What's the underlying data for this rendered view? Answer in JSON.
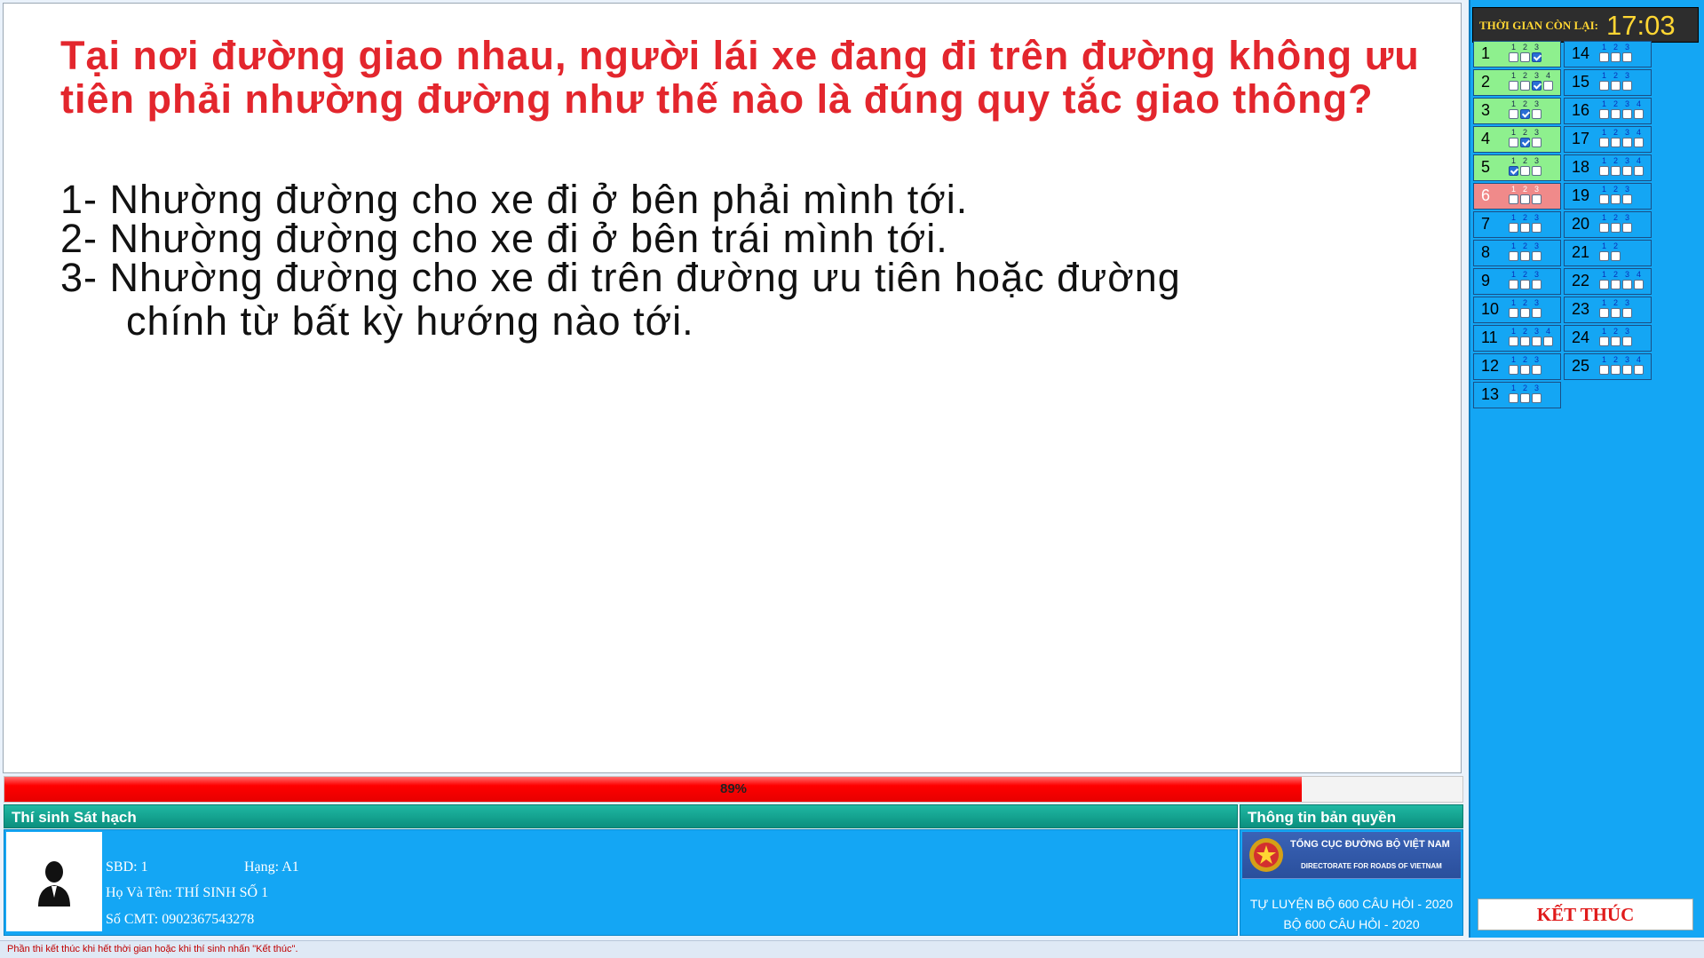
{
  "question": {
    "text": "Tại nơi đường giao nhau, người lái xe đang đi trên đường không ưu tiên phải nhường đường như thế nào là đúng quy tắc giao thông?",
    "answers": [
      {
        "num": "1- ",
        "text": "Nhường đường cho xe đi ở bên phải mình tới.",
        "cont": ""
      },
      {
        "num": "2- ",
        "text": "Nhường đường cho xe đi ở bên trái mình tới.",
        "cont": ""
      },
      {
        "num": "3- ",
        "text": "Nhường đường cho xe đi trên đường ưu tiên hoặc đường",
        "cont": "chính từ bất kỳ hướng nào tới."
      }
    ]
  },
  "progress": {
    "value": 0.89,
    "label": "89%"
  },
  "candidate": {
    "header": "Thí sinh Sát hạch",
    "sbd": "SBD: 1",
    "hang": "Hạng: A1",
    "ho_ten": "Họ Và Tên: THÍ SINH SỐ 1",
    "cmt": "Số CMT: 0902367543278",
    "avatar_icon": "person-silhouette-icon"
  },
  "copyright": {
    "header": "Thông tin bản quyền",
    "org_vi": "TỔNG CỤC ĐƯỜNG BỘ VIỆT NAM",
    "org_en": "DIRECTORATE FOR ROADS OF VIETNAM",
    "line1": "TỰ LUYỆN BỘ 600 CÂU HỎI - 2020",
    "line2": "BỘ 600 CÂU HỎI - 2020"
  },
  "timer": {
    "label": "THỜI GIAN CÒN LẠI:",
    "value": "17:03"
  },
  "questions": [
    {
      "n": "1",
      "opts": [
        "1",
        "2",
        "3"
      ],
      "checked": [
        3
      ],
      "state": "answered"
    },
    {
      "n": "2",
      "opts": [
        "1",
        "2",
        "3",
        "4"
      ],
      "checked": [
        3
      ],
      "state": "answered"
    },
    {
      "n": "3",
      "opts": [
        "1",
        "2",
        "3"
      ],
      "checked": [
        2
      ],
      "state": "answered"
    },
    {
      "n": "4",
      "opts": [
        "1",
        "2",
        "3"
      ],
      "checked": [
        2
      ],
      "state": "answered"
    },
    {
      "n": "5",
      "opts": [
        "1",
        "2",
        "3"
      ],
      "checked": [
        1
      ],
      "state": "answered"
    },
    {
      "n": "6",
      "opts": [
        "1",
        "2",
        "3"
      ],
      "checked": [],
      "state": "current"
    },
    {
      "n": "7",
      "opts": [
        "1",
        "2",
        "3"
      ],
      "checked": [],
      "state": "none"
    },
    {
      "n": "8",
      "opts": [
        "1",
        "2",
        "3"
      ],
      "checked": [],
      "state": "none"
    },
    {
      "n": "9",
      "opts": [
        "1",
        "2",
        "3"
      ],
      "checked": [],
      "state": "none"
    },
    {
      "n": "10",
      "opts": [
        "1",
        "2",
        "3"
      ],
      "checked": [],
      "state": "none"
    },
    {
      "n": "11",
      "opts": [
        "1",
        "2",
        "3",
        "4"
      ],
      "checked": [],
      "state": "none"
    },
    {
      "n": "12",
      "opts": [
        "1",
        "2",
        "3"
      ],
      "checked": [],
      "state": "none"
    },
    {
      "n": "13",
      "opts": [
        "1",
        "2",
        "3"
      ],
      "checked": [],
      "state": "none"
    },
    {
      "n": "14",
      "opts": [
        "1",
        "2",
        "3"
      ],
      "checked": [],
      "state": "none"
    },
    {
      "n": "15",
      "opts": [
        "1",
        "2",
        "3"
      ],
      "checked": [],
      "state": "none"
    },
    {
      "n": "16",
      "opts": [
        "1",
        "2",
        "3",
        "4"
      ],
      "checked": [],
      "state": "none"
    },
    {
      "n": "17",
      "opts": [
        "1",
        "2",
        "3",
        "4"
      ],
      "checked": [],
      "state": "none"
    },
    {
      "n": "18",
      "opts": [
        "1",
        "2",
        "3",
        "4"
      ],
      "checked": [],
      "state": "none"
    },
    {
      "n": "19",
      "opts": [
        "1",
        "2",
        "3"
      ],
      "checked": [],
      "state": "none"
    },
    {
      "n": "20",
      "opts": [
        "1",
        "2",
        "3"
      ],
      "checked": [],
      "state": "none"
    },
    {
      "n": "21",
      "opts": [
        "1",
        "2"
      ],
      "checked": [],
      "state": "none"
    },
    {
      "n": "22",
      "opts": [
        "1",
        "2",
        "3",
        "4"
      ],
      "checked": [],
      "state": "none"
    },
    {
      "n": "23",
      "opts": [
        "1",
        "2",
        "3"
      ],
      "checked": [],
      "state": "none"
    },
    {
      "n": "24",
      "opts": [
        "1",
        "2",
        "3"
      ],
      "checked": [],
      "state": "none"
    },
    {
      "n": "25",
      "opts": [
        "1",
        "2",
        "3",
        "4"
      ],
      "checked": [],
      "state": "none"
    }
  ],
  "finish_label": "KẾT THÚC",
  "footer_note": "Phần thi kết thúc khi hết thời gian hoặc khi thí sinh nhấn \"Kết thúc\".",
  "colors": {
    "question_red": "#e3262d",
    "answered_green": "#8ef08e",
    "current_red": "#f08a8a",
    "panel_blue": "#14a6f4",
    "timer_yellow": "#ffd633"
  }
}
